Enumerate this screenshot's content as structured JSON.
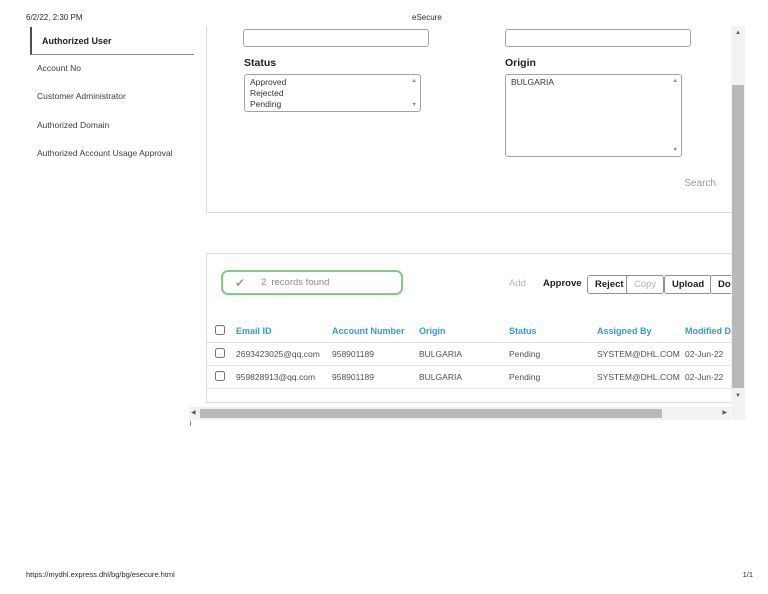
{
  "header": {
    "datetime": "6/2/22, 2:30 PM",
    "title": "eSecure"
  },
  "sidebar": {
    "items": [
      {
        "label": "Authorized User",
        "active": true
      },
      {
        "label": "Account No",
        "active": false
      },
      {
        "label": "Customer Administrator",
        "active": false
      },
      {
        "label": "Authorized Domain",
        "active": false
      },
      {
        "label": "Authorized Account Usage Approval",
        "active": false
      }
    ]
  },
  "search_form": {
    "field1_value": "",
    "field2_value": "",
    "status": {
      "label": "Status",
      "options": [
        "Approved",
        "Rejected",
        "Pending"
      ]
    },
    "origin": {
      "label": "Origin",
      "options": [
        "BULGARIA"
      ]
    },
    "search_label": "Search"
  },
  "results": {
    "records_badge": {
      "count": "2",
      "text": "records found"
    },
    "actions": {
      "add": "Add",
      "approve": "Approve",
      "reject": "Reject",
      "copy": "Copy",
      "upload": "Upload",
      "download": "Dow"
    },
    "table": {
      "headers": {
        "email": "Email ID",
        "account": "Account Number",
        "origin": "Origin",
        "status": "Status",
        "assigned": "Assigned By",
        "modified": "Modified Da"
      },
      "rows": [
        {
          "email": "2693423025@qq.com",
          "account": "958901189",
          "origin": "BULGARIA",
          "status": "Pending",
          "assigned": "SYSTEM@DHL.COM",
          "modified": "02-Jun-22"
        },
        {
          "email": "959828913@qq.com",
          "account": "958901189",
          "origin": "BULGARIA",
          "status": "Pending",
          "assigned": "SYSTEM@DHL.COM",
          "modified": "02-Jun-22"
        }
      ]
    }
  },
  "footer": {
    "url": "https://mydhl.express.dhl/bg/bg/esecure.html",
    "page": "1/1"
  },
  "colors": {
    "header_blue": "#2e9dd8",
    "badge_green": "#84cb84",
    "muted_gray": "#8a8a8a"
  }
}
